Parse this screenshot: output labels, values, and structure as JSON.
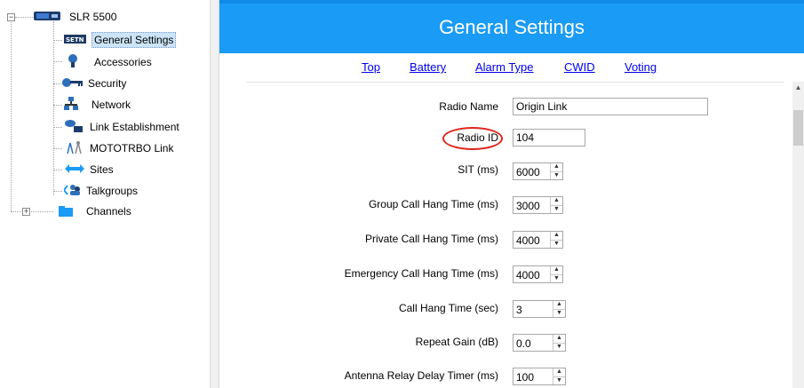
{
  "tree": {
    "root": {
      "label": "SLR 5500",
      "icon": "radio-device-icon",
      "expander": "−"
    },
    "items": [
      {
        "label": "General Settings",
        "icon": "settings-badge-icon",
        "selected": true
      },
      {
        "label": "Accessories",
        "icon": "microphone-icon"
      },
      {
        "label": "Security",
        "icon": "key-icon"
      },
      {
        "label": "Network",
        "icon": "network-icon"
      },
      {
        "label": "Link Establishment",
        "icon": "link-establishment-icon"
      },
      {
        "label": "MOTOTRBO Link",
        "icon": "tower-icon"
      },
      {
        "label": "Sites",
        "icon": "sites-arrows-icon"
      },
      {
        "label": "Talkgroups",
        "icon": "talkgroups-icon"
      },
      {
        "label": "Channels",
        "icon": "folder-icon",
        "expander": "+"
      }
    ]
  },
  "panel": {
    "title": "General Settings",
    "links": [
      "Top",
      "Battery",
      "Alarm Type",
      "CWID",
      "Voting"
    ],
    "fields": {
      "radio_name": {
        "label": "Radio Name",
        "value": "Origin Link"
      },
      "radio_id": {
        "label": "Radio ID",
        "value": "104"
      },
      "sit": {
        "label": "SIT (ms)",
        "value": "6000"
      },
      "group_hang": {
        "label": "Group Call Hang Time (ms)",
        "value": "3000"
      },
      "private_hang": {
        "label": "Private Call Hang Time (ms)",
        "value": "4000"
      },
      "emergency_hang": {
        "label": "Emergency Call Hang Time (ms)",
        "value": "4000"
      },
      "call_hang": {
        "label": "Call Hang Time (sec)",
        "value": "3"
      },
      "repeat_gain": {
        "label": "Repeat Gain (dB)",
        "value": "0.0"
      },
      "antenna_delay": {
        "label": "Antenna Relay Delay Timer (ms)",
        "value": "100"
      }
    }
  },
  "colors": {
    "banner": "#1a9bf5",
    "highlight_circle": "#e0251b",
    "link": "#0000ee"
  }
}
